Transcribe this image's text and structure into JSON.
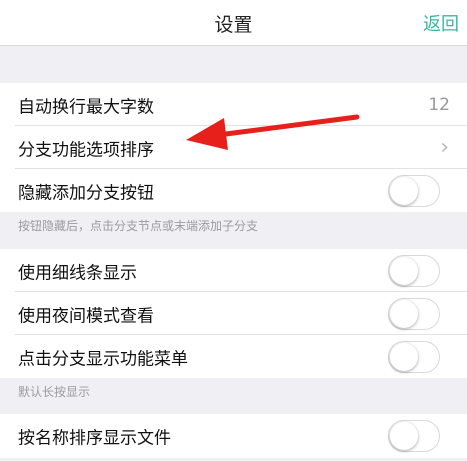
{
  "header": {
    "title": "设置",
    "back_label": "返回"
  },
  "group1": {
    "wrap_max_chars": {
      "label": "自动换行最大字数",
      "value": "12"
    },
    "branch_sort": {
      "label": "分支功能选项排序",
      "chevron": "›"
    },
    "hide_add_branch": {
      "label": "隐藏添加分支按钮",
      "on": false
    }
  },
  "note1": "按钮隐藏后，点击分支节点或末端添加子分支",
  "group2": {
    "thin_lines": {
      "label": "使用细线条显示",
      "on": false
    },
    "night_mode": {
      "label": "使用夜间模式查看",
      "on": false
    },
    "tap_menu": {
      "label": "点击分支显示功能菜单",
      "on": false
    }
  },
  "note2": "默认长按显示",
  "group3": {
    "sort_by_name": {
      "label": "按名称排序显示文件",
      "on": false
    }
  },
  "colors": {
    "accent": "#36b8a0",
    "arrow": "#e8201c",
    "background": "#efeff4"
  },
  "annotation": {
    "icon": "red-arrow-pointing-left"
  }
}
